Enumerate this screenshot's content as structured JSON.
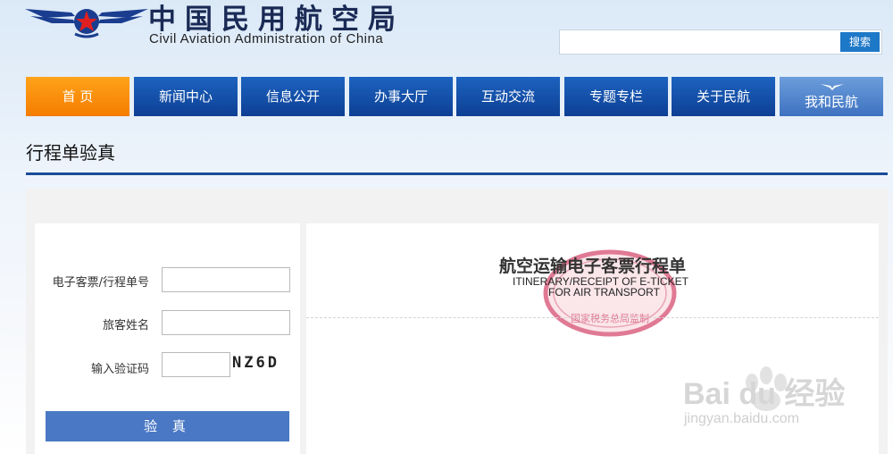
{
  "header": {
    "title_cn": "中国民用航空局",
    "title_en": "Civil Aviation Administration of China",
    "search_button": "搜索",
    "search_value": ""
  },
  "nav": [
    {
      "label": "首 页",
      "active": true
    },
    {
      "label": "新闻中心"
    },
    {
      "label": "信息公开"
    },
    {
      "label": "办事大厅"
    },
    {
      "label": "互动交流"
    },
    {
      "label": "专题专栏"
    },
    {
      "label": "关于民航"
    },
    {
      "label": "我和民航"
    }
  ],
  "page": {
    "title": "行程单验真"
  },
  "form": {
    "ticket_label": "电子客票/行程单号",
    "ticket_value": "",
    "name_label": "旅客姓名",
    "name_value": "",
    "captcha_label": "输入验证码",
    "captcha_value": "",
    "captcha_image_text": "NZ6D",
    "verify_button": "验 真"
  },
  "ticket_header": {
    "title_cn": "航空运输电子客票行程单",
    "title_en_1": "ITINERARY/RECEIPT OF E-TICKET",
    "title_en_2": "FOR AIR TRANSPORT",
    "stamp_text": "国家税务总局监制"
  },
  "watermark": {
    "brand": "Bai du 经验",
    "url": "jingyan.baidu.com"
  },
  "colors": {
    "nav_blue": "#0d3f94",
    "nav_active": "#f57c00",
    "verify_button": "#4a78c4",
    "title_rule": "#1b4c98",
    "stamp_red": "#d94a6a"
  }
}
